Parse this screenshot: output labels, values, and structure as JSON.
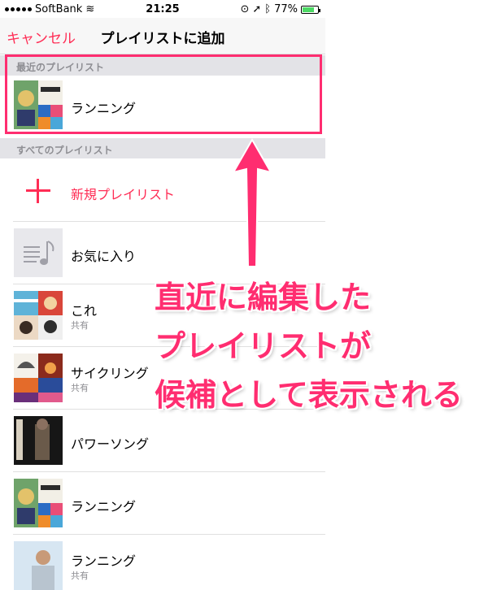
{
  "status": {
    "carrier": "SoftBank",
    "time": "21:25",
    "battery": "77%",
    "battery_level": 0.77
  },
  "nav": {
    "cancel": "キャンセル",
    "title": "プレイリストに追加"
  },
  "sections": {
    "recent": "最近のプレイリスト",
    "all": "すべてのプレイリスト"
  },
  "recent_item": {
    "label": "ランニング"
  },
  "new_playlist": "新規プレイリスト",
  "playlists": [
    {
      "label": "お気に入り",
      "sub": ""
    },
    {
      "label": "これ",
      "sub": "共有"
    },
    {
      "label": "サイクリング",
      "sub": "共有"
    },
    {
      "label": "パワーソング",
      "sub": ""
    },
    {
      "label": "ランニング",
      "sub": ""
    },
    {
      "label": "ランニング",
      "sub": "共有"
    }
  ],
  "annotation": [
    "直近に編集した",
    "プレイリストが",
    "候補として表示される"
  ],
  "colors": {
    "accent": "#ff2d55",
    "annotation": "#ff2d70"
  }
}
